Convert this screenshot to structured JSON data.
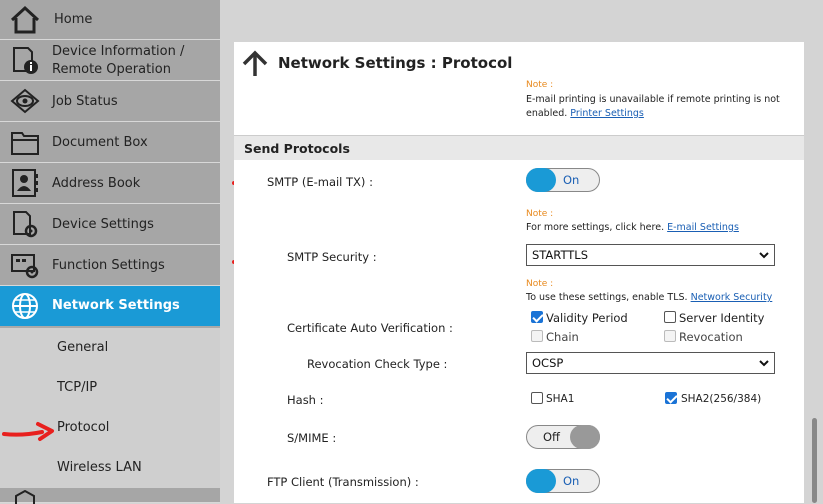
{
  "sidebar": {
    "items": [
      {
        "label": "Home",
        "icon": "home-icon"
      },
      {
        "label": "Device Information / Remote Operation",
        "line1": "Device Information /",
        "line2": "Remote Operation",
        "icon": "device-info-icon"
      },
      {
        "label": "Job Status",
        "icon": "eye-icon"
      },
      {
        "label": "Document Box",
        "icon": "folder-icon"
      },
      {
        "label": "Address Book",
        "icon": "address-book-icon"
      },
      {
        "label": "Device Settings",
        "icon": "device-settings-icon"
      },
      {
        "label": "Function Settings",
        "icon": "function-settings-icon"
      },
      {
        "label": "Network Settings",
        "icon": "globe-icon",
        "active": true
      }
    ],
    "sub_items": [
      {
        "label": "General"
      },
      {
        "label": "TCP/IP"
      },
      {
        "label": "Protocol",
        "selected": true
      },
      {
        "label": "Wireless LAN"
      }
    ]
  },
  "page": {
    "title": "Network Settings : Protocol"
  },
  "notes": {
    "top": {
      "label": "Note :",
      "text": "E-mail printing is unavailable if remote printing is not",
      "text2": "enabled.",
      "link": "Printer Settings"
    },
    "smtp": {
      "label": "Note :",
      "text": "For more settings, click here.",
      "link": "E-mail Settings"
    },
    "security": {
      "label": "Note :",
      "text": "To use these settings, enable TLS.",
      "link": "Network Security"
    }
  },
  "send_protocols": {
    "header": "Send Protocols",
    "smtp": {
      "label": "SMTP (E-mail TX) :",
      "state": "On"
    },
    "smtp_security": {
      "label": "SMTP Security :",
      "value": "STARTTLS"
    },
    "cert_auto": {
      "label": "Certificate Auto Verification :",
      "options": [
        {
          "label": "Validity Period",
          "checked": true,
          "disabled": false
        },
        {
          "label": "Server Identity",
          "checked": false,
          "disabled": false
        },
        {
          "label": "Chain",
          "checked": false,
          "disabled": true
        },
        {
          "label": "Revocation",
          "checked": false,
          "disabled": true
        }
      ]
    },
    "revocation_check": {
      "label": "Revocation Check Type :",
      "value": "OCSP"
    },
    "hash": {
      "label": "Hash :",
      "options": [
        {
          "label": "SHA1",
          "checked": false
        },
        {
          "label": "SHA2(256/384)",
          "checked": true
        }
      ]
    },
    "smime": {
      "label": "S/MIME :",
      "state": "Off"
    },
    "ftp": {
      "label": "FTP Client (Transmission) :",
      "state": "On"
    }
  },
  "colors": {
    "accent": "#1a9ad6",
    "sidebar": "#a6a6a6",
    "note": "#e8891d",
    "annotation": "#e8201e"
  }
}
